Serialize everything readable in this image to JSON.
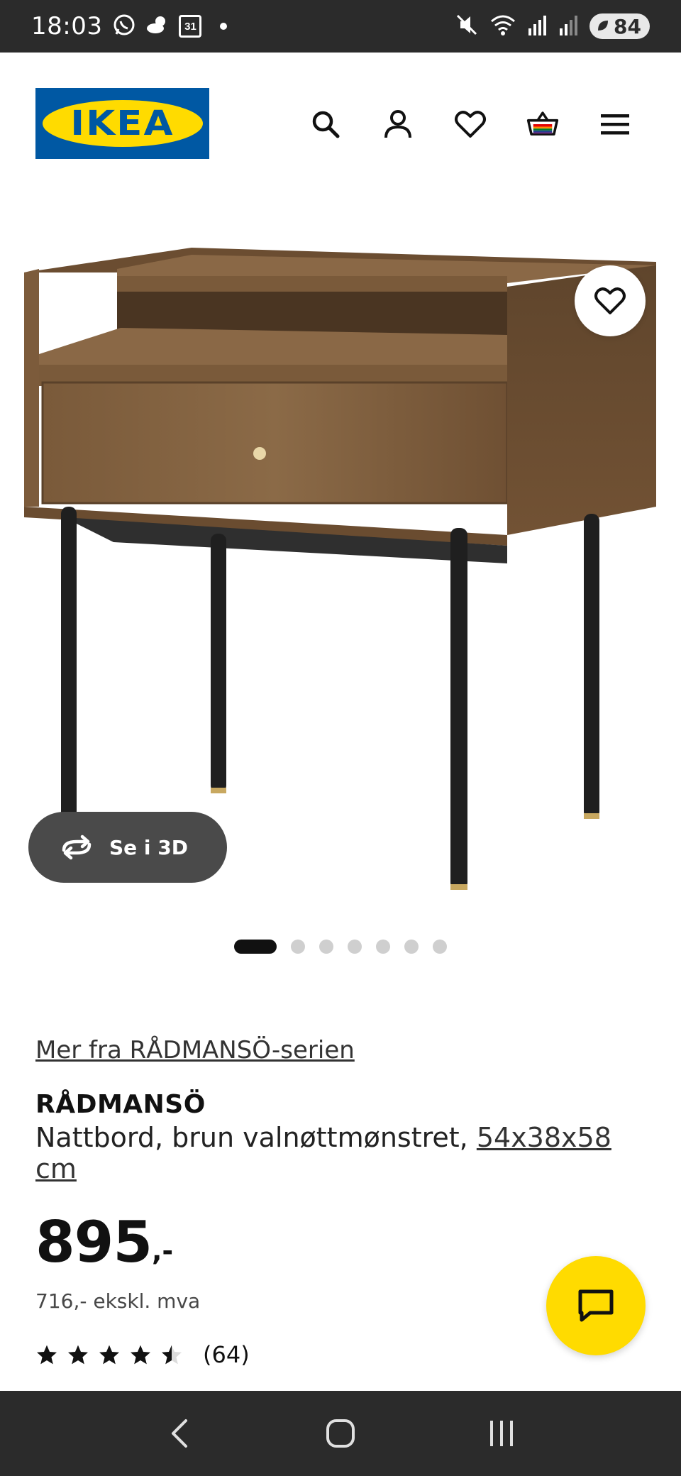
{
  "status_bar": {
    "time": "18:03",
    "calendar_day": "31",
    "battery": "84"
  },
  "brand": {
    "logo_text": "IKEA",
    "primary_color": "#0058a3",
    "accent_color": "#ffdb00"
  },
  "header": {
    "icons": [
      "search-icon",
      "account-icon",
      "heart-icon",
      "cart-icon",
      "menu-icon"
    ]
  },
  "gallery": {
    "view_3d_label": "Se i 3D",
    "slide_count": 7,
    "active_slide": 1
  },
  "product": {
    "series_link": "Mer fra RÅDMANSÖ-serien",
    "name": "RÅDMANSÖ",
    "description": "Nattbord, brun valnøttmønstret, ",
    "dimensions": "54x38x58 cm",
    "price": "895",
    "price_suffix": ",-",
    "price_ex_vat": "716,- ekskl. mva",
    "rating_value": 4.5,
    "rating_max": 5,
    "review_count": "(64)"
  }
}
